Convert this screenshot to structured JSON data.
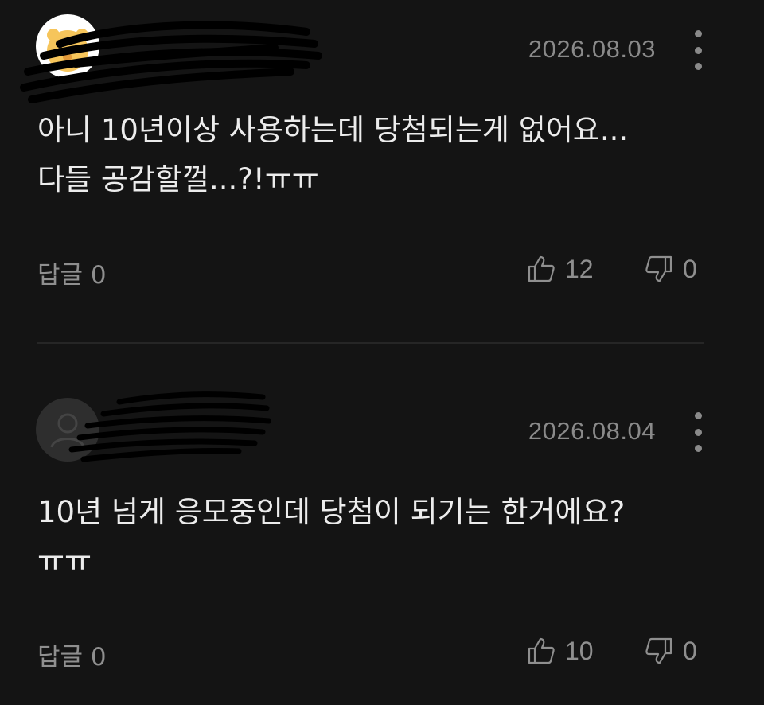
{
  "comments": [
    {
      "date": "2026.08.03",
      "text_lines": [
        "아니 10년이상 사용하는데 당첨되는게 없어요...",
        "다들 공감할껄...?!ㅠㅠ"
      ],
      "reply_label": "답글 0",
      "likes": "12",
      "dislikes": "0",
      "avatar_icon": "character-avatar-icon"
    },
    {
      "date": "2026.08.04",
      "text_lines": [
        "10년 넘게 응모중인데 당첨이 되기는 한거에요?",
        "ㅠㅠ"
      ],
      "reply_label": "답글 0",
      "likes": "10",
      "dislikes": "0",
      "avatar_icon": "default-user-icon"
    }
  ],
  "colors": {
    "background": "#141414",
    "text": "#ececec",
    "muted": "#8f8f8f",
    "divider": "#262626"
  }
}
